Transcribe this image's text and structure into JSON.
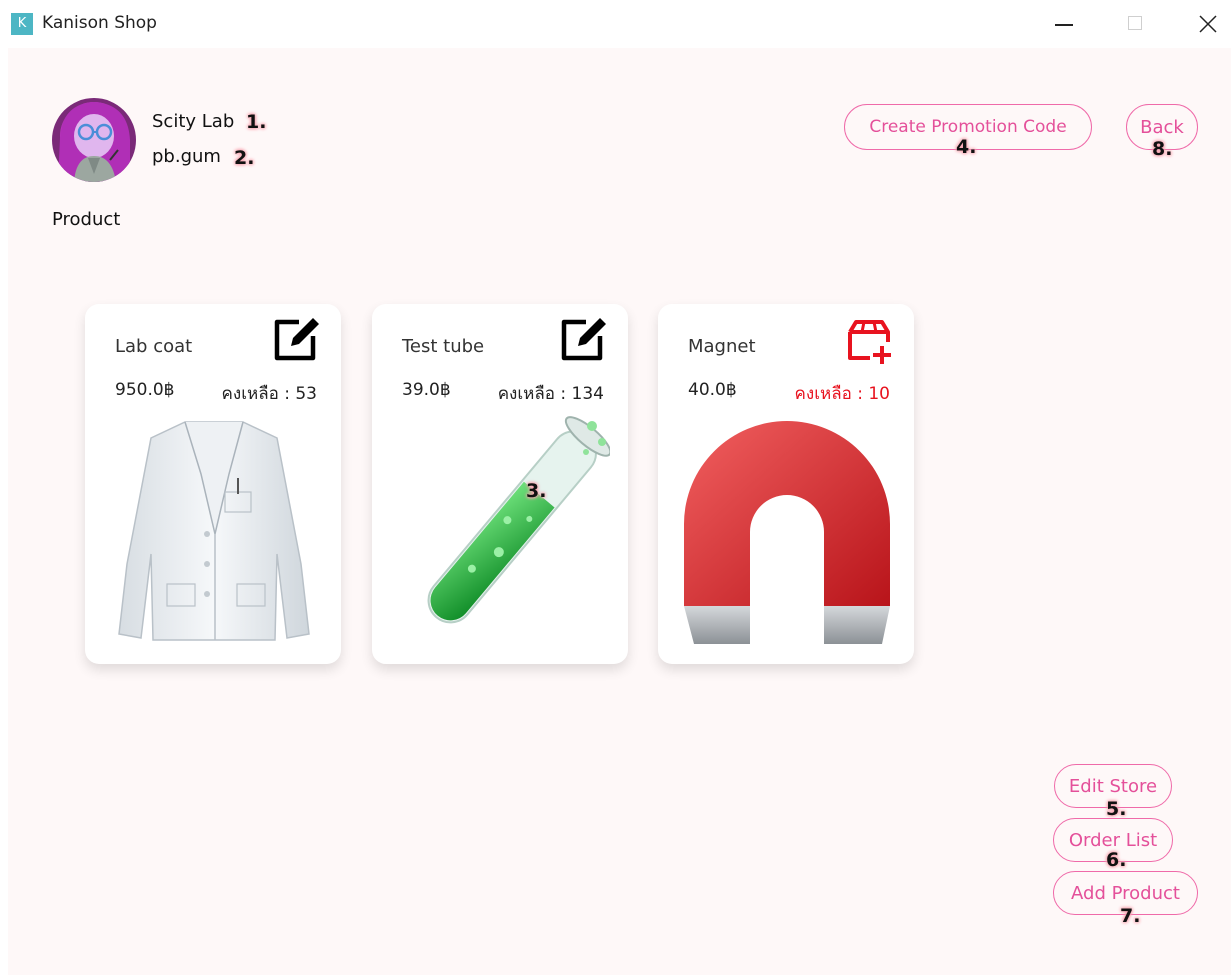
{
  "window": {
    "icon_letter": "K",
    "title": "Kanison Shop"
  },
  "store": {
    "name": "Scity Lab",
    "username": "pb.gum"
  },
  "section_title": "Product",
  "buttons": {
    "create_promo": "Create Promotion Code",
    "back": "Back",
    "edit_store": "Edit Store",
    "order_list": "Order List",
    "add_product": "Add Product"
  },
  "markers": [
    "1.",
    "2.",
    "3.",
    "4.",
    "5.",
    "6.",
    "7.",
    "8."
  ],
  "products": [
    {
      "name": "Lab coat",
      "price": "950.0฿",
      "stock": "คงเหลือ : 53",
      "action_icon": "edit-icon"
    },
    {
      "name": "Test tube",
      "price": "39.0฿",
      "stock": "คงเหลือ : 134",
      "action_icon": "edit-icon"
    },
    {
      "name": "Magnet",
      "price": "40.0฿",
      "stock": "คงเหลือ : 10",
      "action_icon": "restock-icon",
      "low_stock": true
    }
  ],
  "colors": {
    "accent": "#e4509a",
    "accent_border": "#ef6aa9",
    "low_stock": "#e8131f",
    "background": "#fef8f8"
  }
}
